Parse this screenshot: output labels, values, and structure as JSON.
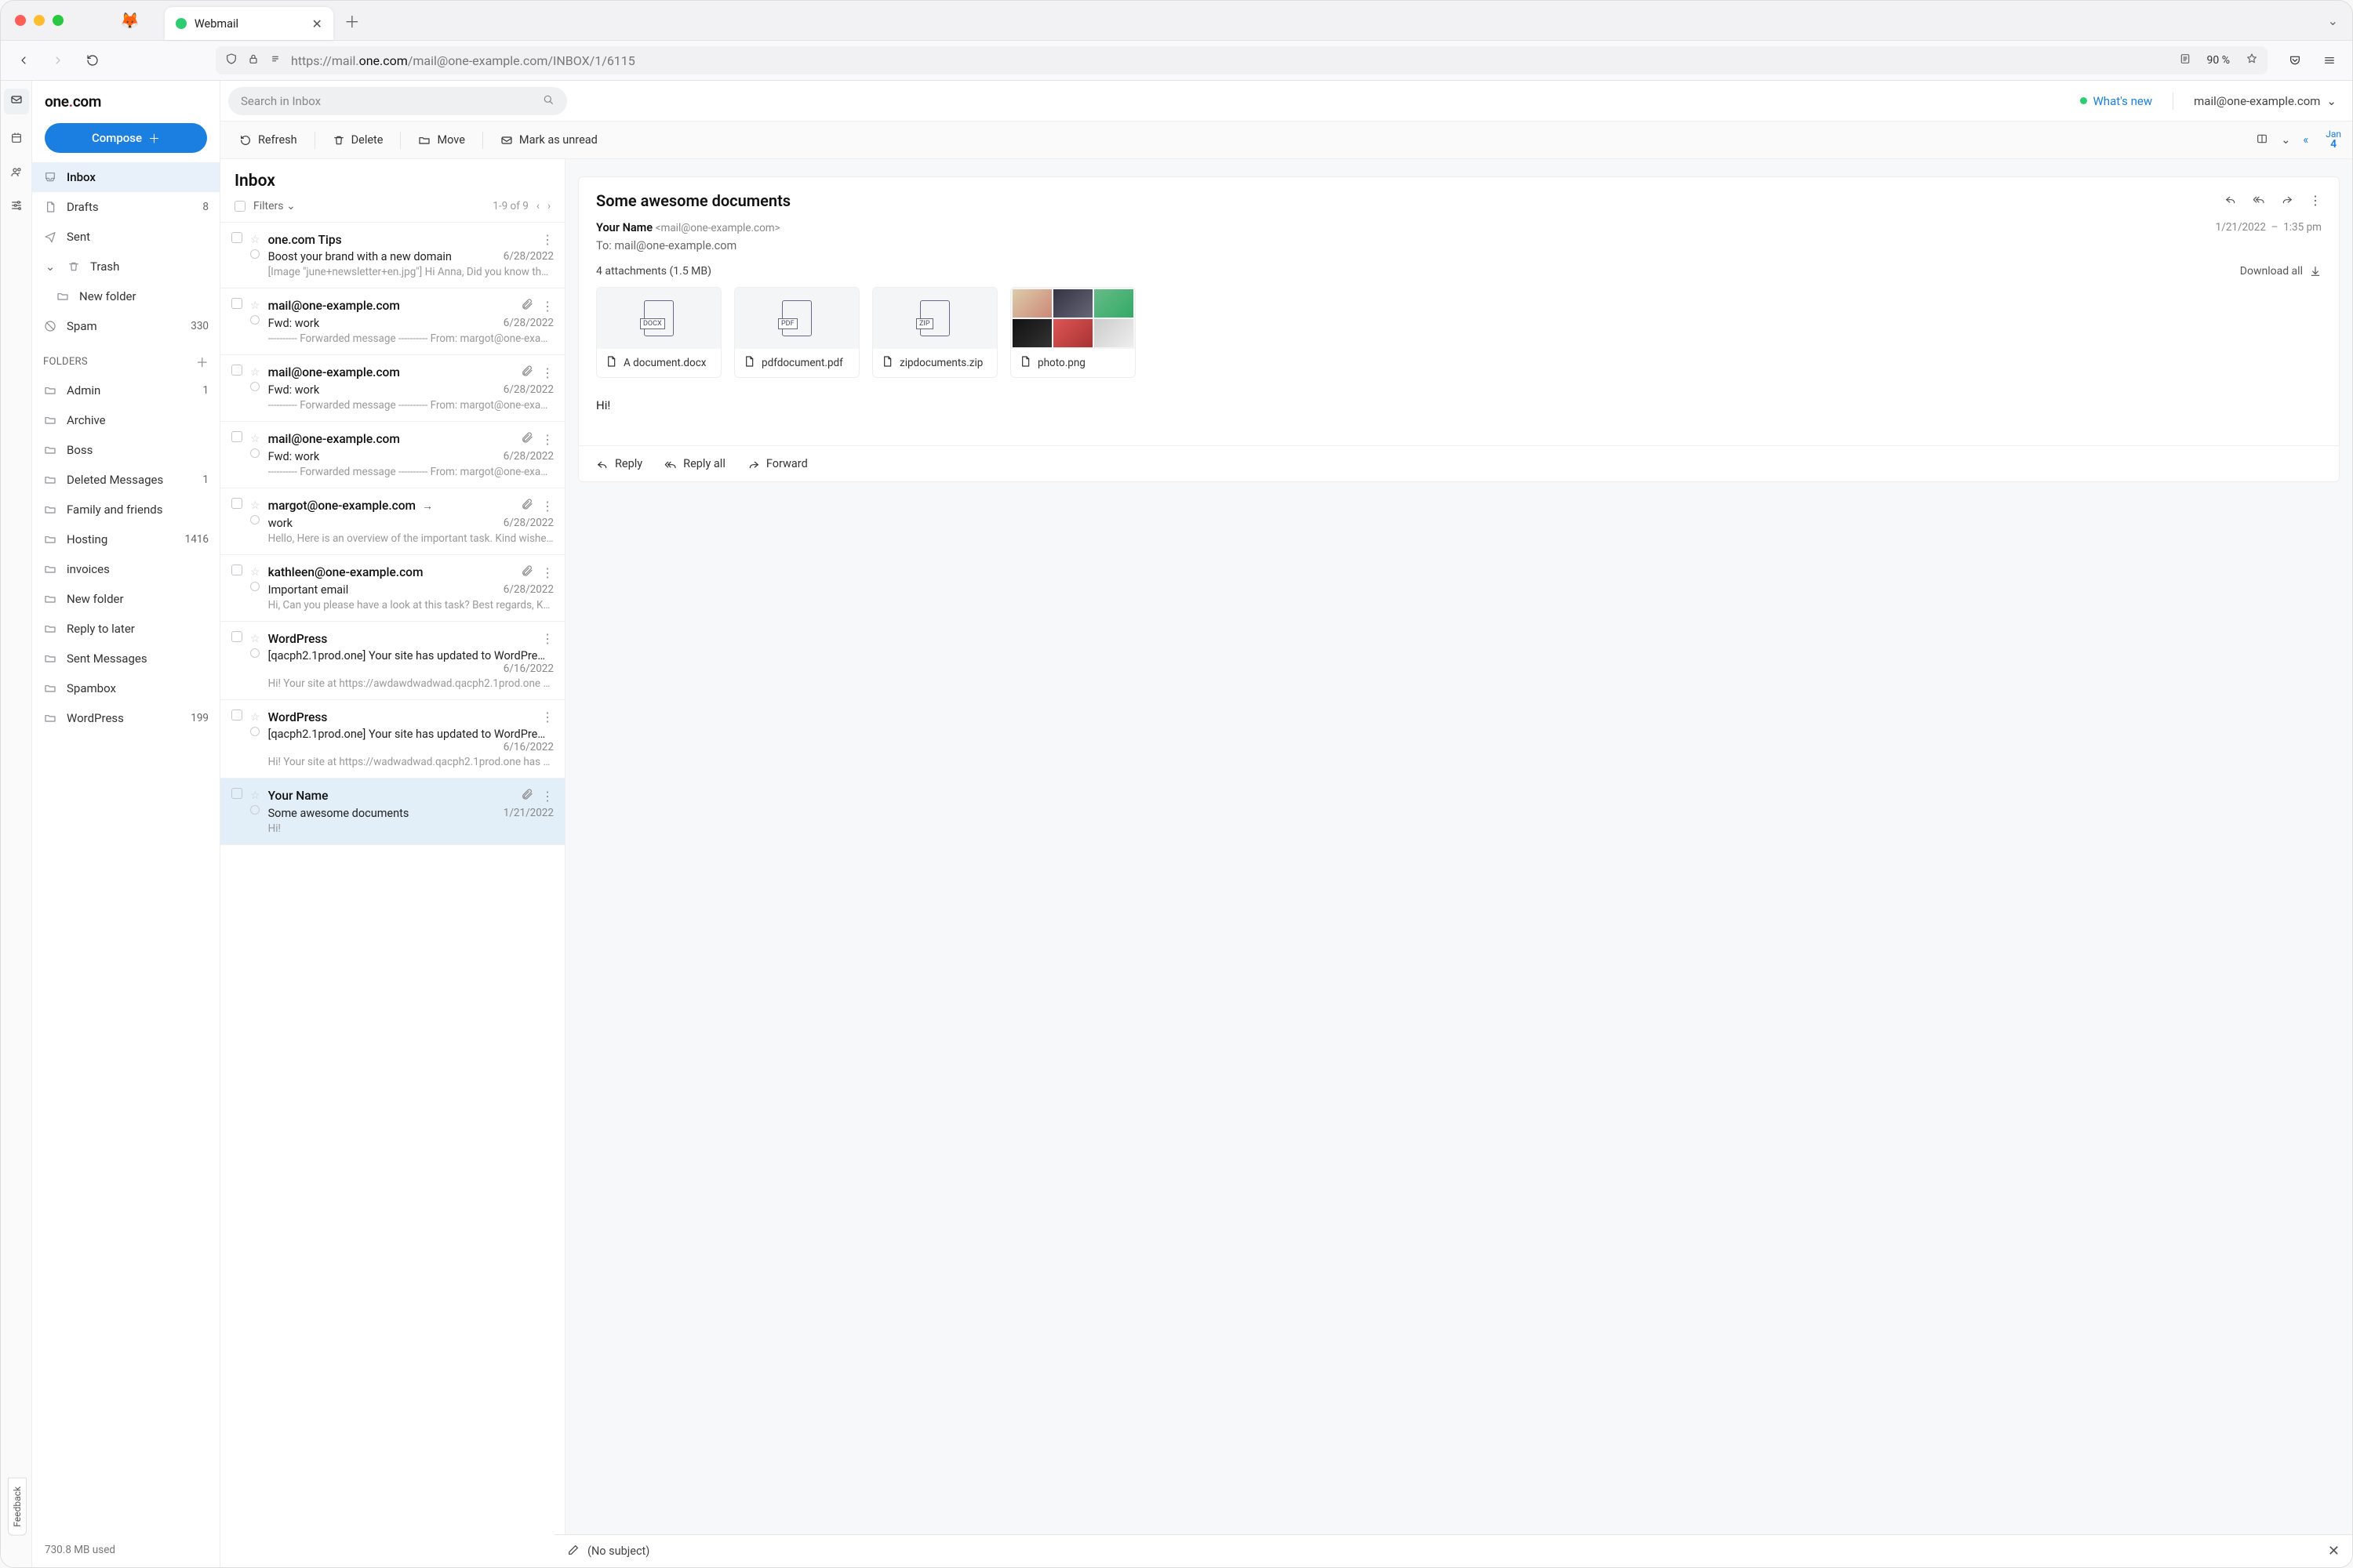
{
  "browser": {
    "tab_title": "Webmail",
    "url_prefix": "https://mail.",
    "url_domain": "one.com",
    "url_path": "/mail@one-example.com/INBOX/1/6115",
    "zoom": "90 %"
  },
  "brand": "one.com",
  "search_placeholder": "Search in Inbox",
  "whats_new": "What's new",
  "account": "mail@one-example.com",
  "compose": "Compose",
  "toolbar": {
    "refresh": "Refresh",
    "delete": "Delete",
    "move": "Move",
    "mark_unread": "Mark as unread",
    "date_month": "Jan",
    "date_day": "4"
  },
  "sys_folders": [
    {
      "icon": "inbox",
      "label": "Inbox",
      "selected": true
    },
    {
      "icon": "draft",
      "label": "Drafts",
      "count": "8"
    },
    {
      "icon": "sent",
      "label": "Sent"
    },
    {
      "icon": "trash",
      "label": "Trash",
      "expandable": true
    },
    {
      "icon": "sub",
      "label": "New folder",
      "sub": true
    },
    {
      "icon": "spam",
      "label": "Spam",
      "count": "330"
    }
  ],
  "folders_header": "FOLDERS",
  "folders": [
    {
      "label": "Admin",
      "count": "1"
    },
    {
      "label": "Archive"
    },
    {
      "label": "Boss"
    },
    {
      "label": "Deleted Messages",
      "count": "1"
    },
    {
      "label": "Family and friends"
    },
    {
      "label": "Hosting",
      "count": "1416"
    },
    {
      "label": "invoices"
    },
    {
      "label": "New folder"
    },
    {
      "label": "Reply to later"
    },
    {
      "label": "Sent Messages"
    },
    {
      "label": "Spambox"
    },
    {
      "label": "WordPress",
      "count": "199"
    }
  ],
  "quota": "730.8 MB used",
  "list": {
    "title": "Inbox",
    "filters": "Filters",
    "range": "1-9 of 9",
    "items": [
      {
        "from": "one.com Tips",
        "subject": "Boost your brand with a new domain",
        "date": "6/28/2022",
        "preview": "[Image \"june+newsletter+en.jpg\"] Hi Anna, Did you know that we…"
      },
      {
        "from": "mail@one-example.com",
        "subject": "Fwd: work",
        "date": "6/28/2022",
        "preview": "---------- Forwarded message ---------- From: margot@one-examp…",
        "clip": true
      },
      {
        "from": "mail@one-example.com",
        "subject": "Fwd: work",
        "date": "6/28/2022",
        "preview": "---------- Forwarded message ---------- From: margot@one-examp…",
        "clip": true
      },
      {
        "from": "mail@one-example.com",
        "subject": "Fwd: work",
        "date": "6/28/2022",
        "preview": "---------- Forwarded message ---------- From: margot@one-examp…",
        "clip": true
      },
      {
        "from": "margot@one-example.com",
        "subject": "work",
        "date": "6/28/2022",
        "preview": "Hello, Here is an overview of the important task. Kind wishes, Mar…",
        "clip": true,
        "fwd": true
      },
      {
        "from": "kathleen@one-example.com",
        "subject": "Important email",
        "date": "6/28/2022",
        "preview": "Hi, Can you please have a look at this task? Best regards, Kathleen",
        "clip": true
      },
      {
        "from": "WordPress",
        "subject": "[qacph2.1prod.one] Your site has updated to WordPre…",
        "date": "6/16/2022",
        "preview": "Hi! Your site at https://awdawdwadwad.qacph2.1prod.one has bee…"
      },
      {
        "from": "WordPress",
        "subject": "[qacph2.1prod.one] Your site has updated to WordPre…",
        "date": "6/16/2022",
        "preview": "Hi! Your site at https://wadwadwad.qacph2.1prod.one has been u…"
      },
      {
        "from": "Your Name",
        "subject": "Some awesome documents",
        "date": "1/21/2022",
        "preview": "Hi!",
        "clip": true,
        "selected": true
      }
    ]
  },
  "reader": {
    "subject": "Some awesome documents",
    "from_name": "Your Name",
    "from_addr": "<mail@one-example.com>",
    "date": "1/21/2022",
    "time_sep": "–",
    "time": "1:35 pm",
    "to_label": "To:",
    "to": "mail@one-example.com",
    "att_summary": "4 attachments (1.5 MB)",
    "download_all": "Download all",
    "attachments": [
      {
        "name": "A document.docx",
        "badge": "DOCX"
      },
      {
        "name": "pdfdocument.pdf",
        "badge": "PDF"
      },
      {
        "name": "zipdocuments.zip",
        "badge": "ZIP"
      },
      {
        "name": "photo.png",
        "thumb": "photo"
      }
    ],
    "body": "Hi!",
    "reply": "Reply",
    "reply_all": "Reply all",
    "forward": "Forward"
  },
  "draft_bar": "(No subject)",
  "feedback": "Feedback"
}
